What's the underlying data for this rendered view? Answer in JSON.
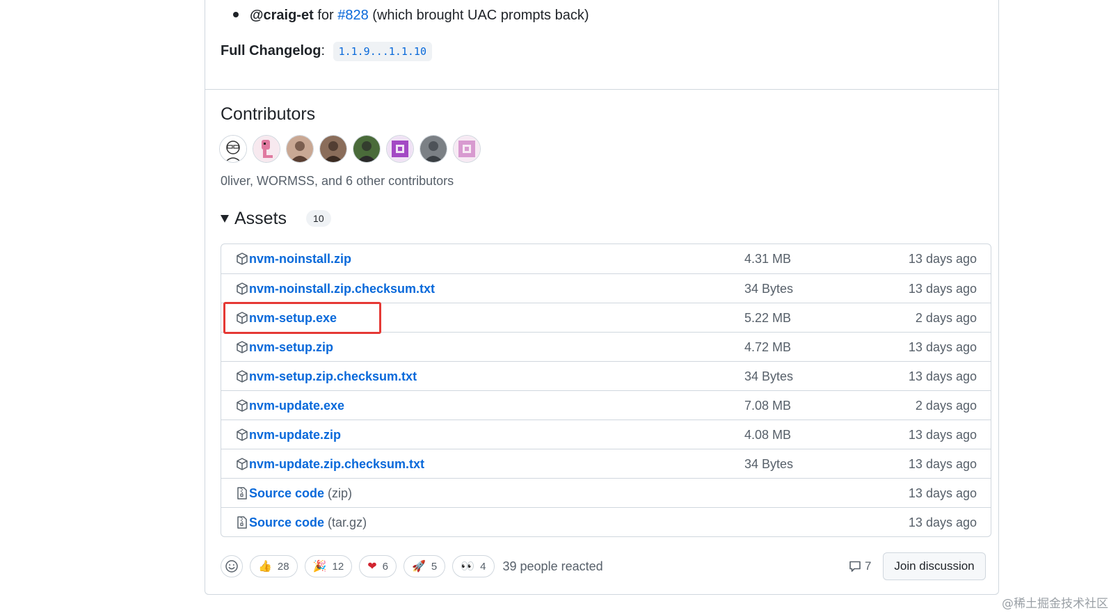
{
  "notes": {
    "mention": "@craig-et",
    "for_text": "for",
    "pr_link": "#828",
    "pr_desc": "(which brought UAC prompts back)",
    "changelog_label": "Full Changelog",
    "changelog_colon": ":",
    "changelog_range": "1.1.9...1.1.10"
  },
  "contributors": {
    "title": "Contributors",
    "summary": "0liver, WORMSS, and 6 other contributors",
    "avatars": [
      {
        "name": "0liver",
        "bg": "#ffffff",
        "fg": "#333333"
      },
      {
        "name": "WORMSS",
        "bg": "#f7e9ef",
        "fg": "#e07aa0"
      },
      {
        "name": "contributor-3",
        "bg": "#c9a894",
        "fg": "#5a3f32"
      },
      {
        "name": "contributor-4",
        "bg": "#8a6d5a",
        "fg": "#3b2b22"
      },
      {
        "name": "contributor-5",
        "bg": "#4a6b3a",
        "fg": "#2a2a2a"
      },
      {
        "name": "contributor-6",
        "bg": "#f0e3f5",
        "fg": "#a349c4"
      },
      {
        "name": "contributor-7",
        "bg": "#7b8085",
        "fg": "#3a3f44"
      },
      {
        "name": "contributor-8",
        "bg": "#f7eaf4",
        "fg": "#d89ad0"
      }
    ]
  },
  "assets": {
    "title": "Assets",
    "count": "10",
    "items": [
      {
        "name": "nvm-noinstall.zip",
        "suffix": "",
        "icon": "package-icon",
        "size": "4.31 MB",
        "date": "13 days ago"
      },
      {
        "name": "nvm-noinstall.zip.checksum.txt",
        "suffix": "",
        "icon": "package-icon",
        "size": "34 Bytes",
        "date": "13 days ago"
      },
      {
        "name": "nvm-setup.exe",
        "suffix": "",
        "icon": "package-icon",
        "size": "5.22 MB",
        "date": "2 days ago"
      },
      {
        "name": "nvm-setup.zip",
        "suffix": "",
        "icon": "package-icon",
        "size": "4.72 MB",
        "date": "13 days ago"
      },
      {
        "name": "nvm-setup.zip.checksum.txt",
        "suffix": "",
        "icon": "package-icon",
        "size": "34 Bytes",
        "date": "13 days ago"
      },
      {
        "name": "nvm-update.exe",
        "suffix": "",
        "icon": "package-icon",
        "size": "7.08 MB",
        "date": "2 days ago"
      },
      {
        "name": "nvm-update.zip",
        "suffix": "",
        "icon": "package-icon",
        "size": "4.08 MB",
        "date": "13 days ago"
      },
      {
        "name": "nvm-update.zip.checksum.txt",
        "suffix": "",
        "icon": "package-icon",
        "size": "34 Bytes",
        "date": "13 days ago"
      },
      {
        "name": "Source code",
        "suffix": "(zip)",
        "icon": "file-zip-icon",
        "size": "",
        "date": "13 days ago"
      },
      {
        "name": "Source code",
        "suffix": "(tar.gz)",
        "icon": "file-zip-icon",
        "size": "",
        "date": "13 days ago"
      }
    ]
  },
  "reactions": {
    "items": [
      {
        "emoji": "👍",
        "icon": "thumbs-up-icon",
        "count": "28"
      },
      {
        "emoji": "🎉",
        "icon": "tada-icon",
        "count": "12"
      },
      {
        "emoji": "❤",
        "icon": "heart-icon",
        "count": "6"
      },
      {
        "emoji": "🚀",
        "icon": "rocket-icon",
        "count": "5"
      },
      {
        "emoji": "👀",
        "icon": "eyes-icon",
        "count": "4"
      }
    ],
    "summary": "39 people reacted",
    "comments": "7",
    "join_label": "Join discussion"
  },
  "watermark": "@稀土掘金技术社区",
  "colors": {
    "link": "#0969da",
    "muted": "#57606a",
    "border": "#d0d7de",
    "highlight": "#e53935"
  }
}
